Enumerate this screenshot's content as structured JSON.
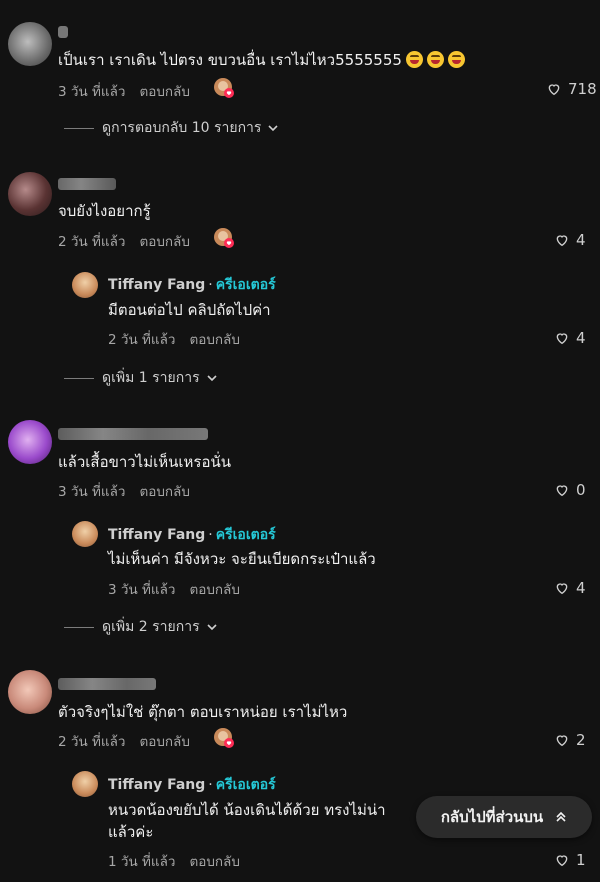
{
  "comments": [
    {
      "text": "เป็นเรา เราเดิน ไปตรง ขบวนอื่น เราไม่ไหว5555555",
      "time": "3 วัน ที่แล้ว",
      "reply_label": "ตอบกลับ",
      "likes": "718",
      "thread_label": "ดูการตอบกลับ 10 รายการ",
      "emoji_count": 3
    },
    {
      "text": "จบยังไงอยากรู้",
      "time": "2 วัน ที่แล้ว",
      "reply_label": "ตอบกลับ",
      "likes": "4",
      "thread_label": "ดูเพิ่ม 1 รายการ",
      "reply": {
        "author": "Tiffany Fang",
        "badge": "ครีเอเตอร์",
        "text": "มีตอนต่อไป คลิปถัดไปค่า",
        "time": "2 วัน ที่แล้ว",
        "reply_label": "ตอบกลับ",
        "likes": "4"
      }
    },
    {
      "text": "แล้วเสื้อขาวไม่เห็นเหรอนั่น",
      "time": "3 วัน ที่แล้ว",
      "reply_label": "ตอบกลับ",
      "likes": "0",
      "thread_label": "ดูเพิ่ม 2 รายการ",
      "reply": {
        "author": "Tiffany Fang",
        "badge": "ครีเอเตอร์",
        "text": "ไม่เห็นค่า มีจังหวะ จะยืนเบียดกระเป๋าแล้ว",
        "time": "3 วัน ที่แล้ว",
        "reply_label": "ตอบกลับ",
        "likes": "4"
      }
    },
    {
      "text": "ตัวจริงๆไม่ใช่ ตุ๊กตา ตอบเราหน่อย เราไม่ไหว",
      "time": "2 วัน ที่แล้ว",
      "reply_label": "ตอบกลับ",
      "likes": "2",
      "reply": {
        "author": "Tiffany Fang",
        "badge": "ครีเอเตอร์",
        "text_line1": "หนวดน้องขยับได้ น้องเดินได้ด้วย ทรงไม่น่า",
        "text_line2": "แล้วค่ะ",
        "time": "1 วัน ที่แล้ว",
        "reply_label": "ตอบกลับ",
        "likes": "1"
      }
    }
  ],
  "back_to_top": {
    "label": "กลับไปที่ส่วนบน"
  },
  "colors": {
    "background": "#121212",
    "creator_badge": "#25c7d6",
    "muted": "#a6a6a6"
  }
}
